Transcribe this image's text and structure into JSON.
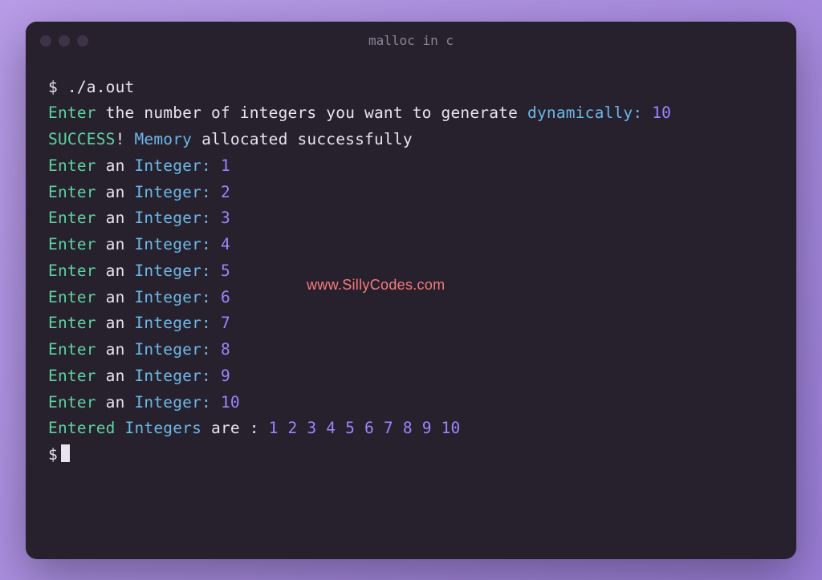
{
  "window": {
    "title": "malloc in c"
  },
  "terminal": {
    "prompt": "$",
    "command": "./a.out",
    "line2": {
      "enter": "Enter",
      "mid": " the number of integers you want to generate ",
      "dyn": "dynamically:",
      "val": " 10"
    },
    "line3": {
      "success": "SUCCESS",
      "bang": "!",
      "memory": " Memory",
      "rest": " allocated successfully"
    },
    "inputs": [
      {
        "enter": "Enter",
        "an": " an ",
        "integer": "Integer:",
        "val": " 1"
      },
      {
        "enter": "Enter",
        "an": " an ",
        "integer": "Integer:",
        "val": " 2"
      },
      {
        "enter": "Enter",
        "an": " an ",
        "integer": "Integer:",
        "val": " 3"
      },
      {
        "enter": "Enter",
        "an": " an ",
        "integer": "Integer:",
        "val": " 4"
      },
      {
        "enter": "Enter",
        "an": " an ",
        "integer": "Integer:",
        "val": " 5"
      },
      {
        "enter": "Enter",
        "an": " an ",
        "integer": "Integer:",
        "val": " 6"
      },
      {
        "enter": "Enter",
        "an": " an ",
        "integer": "Integer:",
        "val": " 7"
      },
      {
        "enter": "Enter",
        "an": " an ",
        "integer": "Integer:",
        "val": " 8"
      },
      {
        "enter": "Enter",
        "an": " an ",
        "integer": "Integer:",
        "val": " 9"
      },
      {
        "enter": "Enter",
        "an": " an ",
        "integer": "Integer:",
        "val": " 10"
      }
    ],
    "result": {
      "entered": "Entered",
      "integers": " Integers",
      "are": " are : ",
      "values": "1 2 3 4 5 6 7 8 9 10"
    }
  },
  "watermark": "www.SillyCodes.com"
}
